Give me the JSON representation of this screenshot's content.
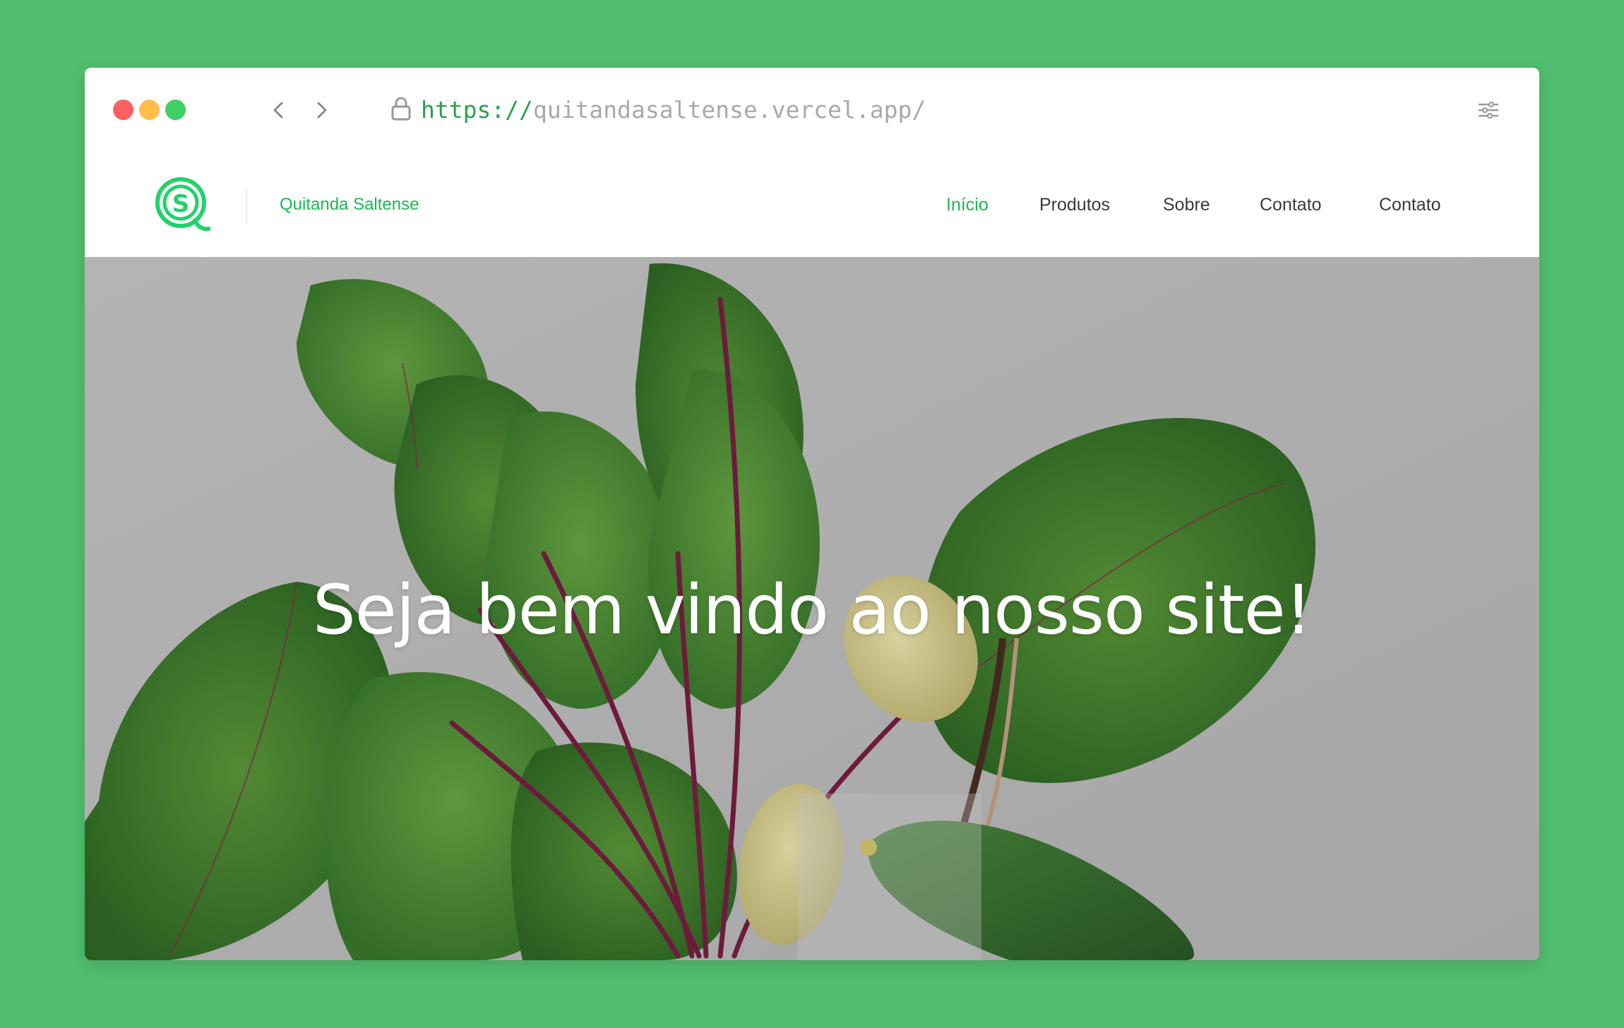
{
  "browser": {
    "url_protocol": "https://",
    "url_host": "quitandasaltense.vercel.app/",
    "window_buttons": [
      {
        "name": "close",
        "color": "#ff6061"
      },
      {
        "name": "minimize",
        "color": "#ffbe4a"
      },
      {
        "name": "maximize",
        "color": "#3fcf64"
      }
    ],
    "icons": [
      "chevron-left-icon",
      "chevron-right-icon",
      "lock-icon",
      "sliders-icon"
    ]
  },
  "site": {
    "brand": "Quitanda Saltense",
    "logo_letter": "S",
    "accent_color": "#1cb74f",
    "nav": [
      {
        "label": "Início",
        "active": true
      },
      {
        "label": "Produtos",
        "active": false
      },
      {
        "label": "Sobre",
        "active": false
      },
      {
        "label": "Contato",
        "active": false
      },
      {
        "label": "Contato",
        "active": false
      }
    ]
  },
  "hero": {
    "title": "Seja bem vindo ao nosso site!"
  }
}
